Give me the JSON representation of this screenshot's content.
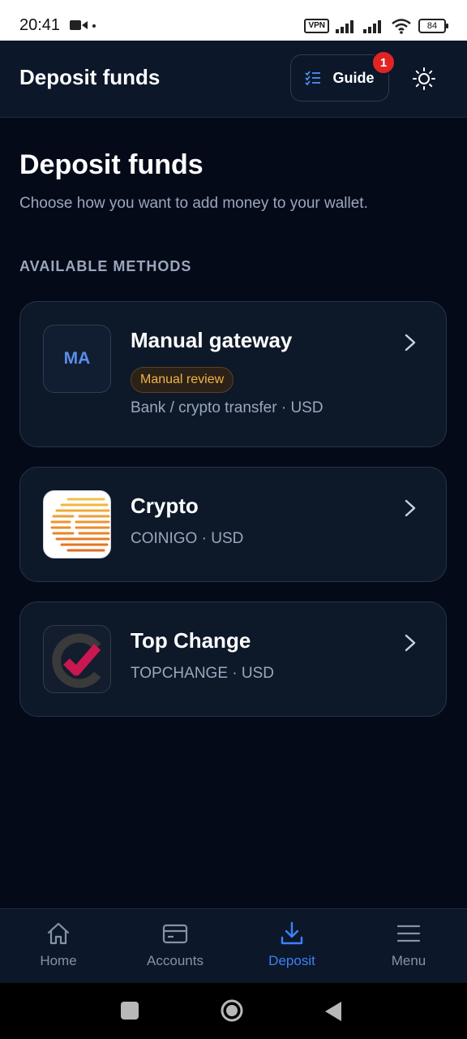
{
  "status_bar": {
    "time": "20:41",
    "vpn": "VPN",
    "battery": "84"
  },
  "header": {
    "title": "Deposit funds",
    "guide_label": "Guide",
    "guide_badge": "1",
    "theme_icon": "sun-icon"
  },
  "main": {
    "title": "Deposit funds",
    "subtitle": "Choose how you want to add money to your wallet.",
    "section_label": "AVAILABLE METHODS"
  },
  "methods": [
    {
      "logo_text": "MA",
      "name": "Manual gateway",
      "badge": "Manual review",
      "meta": "Bank / crypto transfer · USD"
    },
    {
      "logo_icon": "coinigo-logo-icon",
      "name": "Crypto",
      "meta": "COINIGO · USD"
    },
    {
      "logo_icon": "topchange-logo-icon",
      "name": "Top Change",
      "meta": "TOPCHANGE · USD"
    }
  ],
  "bottom_nav": [
    {
      "label": "Home",
      "icon": "home-icon"
    },
    {
      "label": "Accounts",
      "icon": "card-icon"
    },
    {
      "label": "Deposit",
      "icon": "download-icon",
      "active": true
    },
    {
      "label": "Menu",
      "icon": "menu-icon"
    }
  ],
  "colors": {
    "background": "#050a18",
    "surface": "#0d1829",
    "accent": "#3b82f6",
    "badge_red": "#e02424",
    "review_amber": "#f2b544"
  }
}
